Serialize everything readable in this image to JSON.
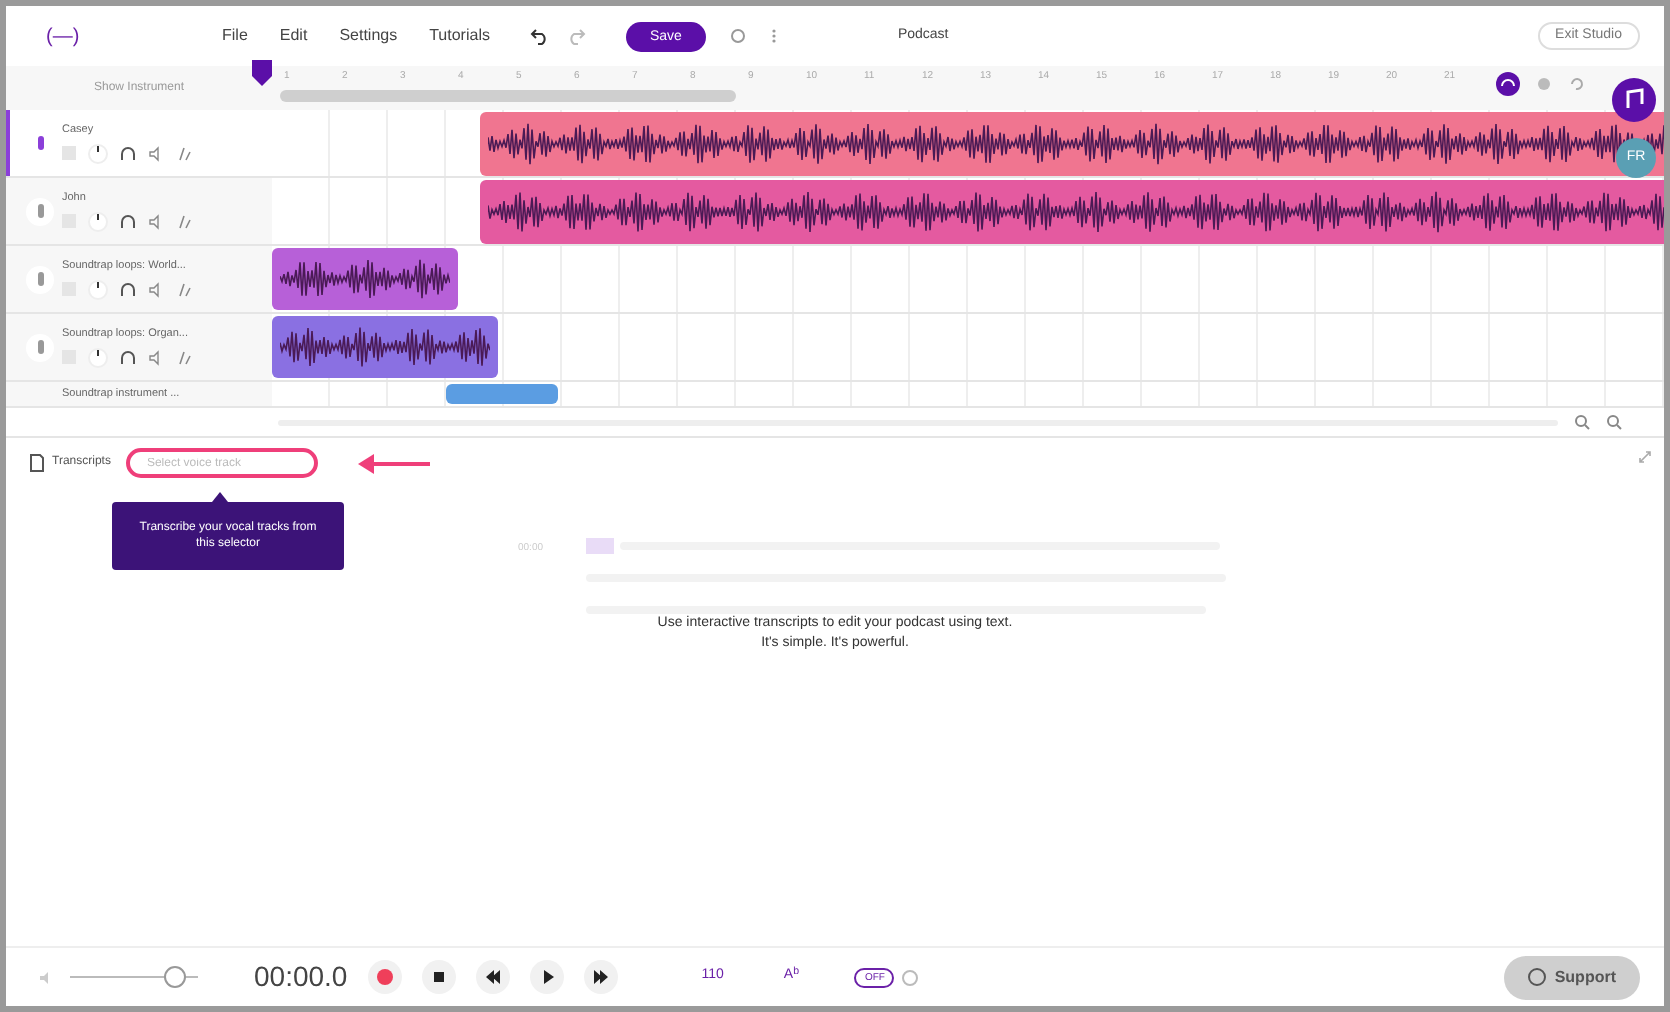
{
  "logo": "(—)",
  "menu": [
    "File",
    "Edit",
    "Settings",
    "Tutorials"
  ],
  "save_button": "Save",
  "project_title": "Podcast",
  "exit_button": "Exit Studio",
  "show_instrument": "Show Instrument",
  "ruler": [
    "1",
    "2",
    "3",
    "4",
    "5",
    "6",
    "7",
    "8",
    "9",
    "10",
    "11",
    "12",
    "13",
    "14",
    "15",
    "16",
    "17",
    "18",
    "19",
    "20",
    "21"
  ],
  "avatar": "FR",
  "tracks": [
    {
      "name": "Casey",
      "selected": true,
      "color": "#f07590"
    },
    {
      "name": "John",
      "selected": false,
      "color": "#e45aa0"
    },
    {
      "name": "Soundtrap loops: World...",
      "selected": false,
      "color": "#b760d8"
    },
    {
      "name": "Soundtrap loops: Organ...",
      "selected": false,
      "color": "#8a70e2"
    },
    {
      "name": "Soundtrap instrument ...",
      "selected": false,
      "color": "#5b9de2"
    }
  ],
  "transcripts": {
    "label": "Transcripts",
    "placeholder": "Select voice track",
    "tooltip": "Transcribe your vocal tracks from this selector",
    "timestamp": "00:00",
    "message": [
      "Use interactive transcripts to edit your podcast using text.",
      "It's simple. It's powerful."
    ]
  },
  "footer": {
    "volume": {
      "level": 0.82
    },
    "time": "00:00.0",
    "tempo": "110",
    "key": "A$^{b}$",
    "toggle": "OFF",
    "support": "Support"
  }
}
